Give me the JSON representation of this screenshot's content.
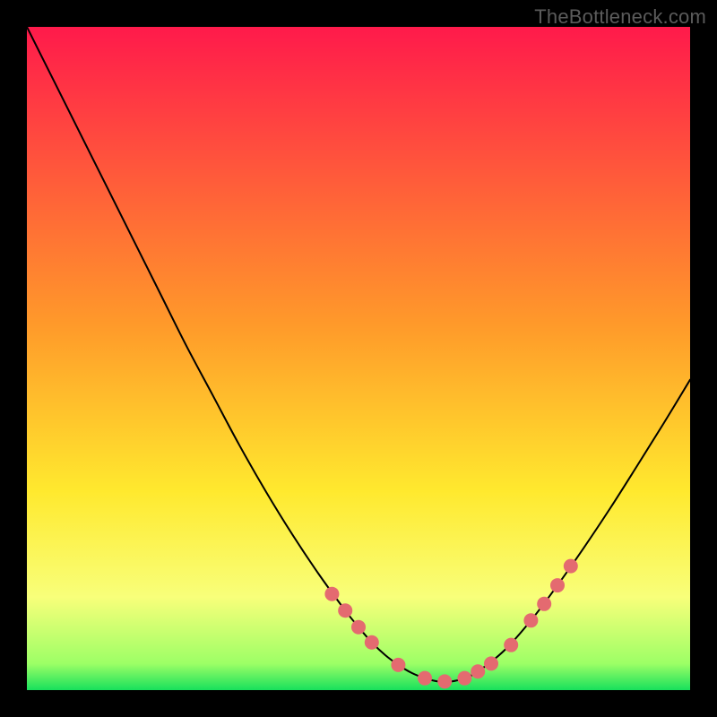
{
  "watermark": "TheBottleneck.com",
  "colors": {
    "gradient": [
      "#ff1a4b",
      "#ff9a2a",
      "#ffe92e",
      "#f8ff7a",
      "#9dff66",
      "#18e05c"
    ],
    "dot_fill": "#e46a70",
    "curve_stroke": "#000000"
  },
  "chart_data": {
    "type": "line",
    "title": "",
    "xlabel": "",
    "ylabel": "",
    "xlim": [
      0,
      100
    ],
    "ylim": [
      0,
      100
    ],
    "grid": false,
    "legend": false,
    "x": [
      0,
      4,
      8,
      12,
      16,
      20,
      24,
      28,
      32,
      36,
      40,
      44,
      48,
      50,
      52,
      54,
      56,
      58,
      60,
      62,
      64,
      66,
      68,
      72,
      76,
      80,
      84,
      88,
      92,
      96,
      100
    ],
    "y": [
      100,
      92,
      84,
      76,
      68,
      60,
      52,
      44.5,
      37,
      30,
      23.5,
      17.5,
      12,
      9.5,
      7.2,
      5.3,
      3.8,
      2.6,
      1.8,
      1.3,
      1.3,
      1.8,
      2.8,
      6.0,
      10.5,
      15.8,
      21.5,
      27.5,
      33.8,
      40.2,
      46.8
    ],
    "dot_x": [
      46,
      48,
      50,
      52,
      56,
      60,
      63,
      66,
      68,
      70,
      73,
      76,
      78,
      80,
      82
    ],
    "dot_y": [
      14.5,
      12.0,
      9.5,
      7.2,
      3.8,
      1.8,
      1.3,
      1.8,
      2.8,
      4.0,
      6.8,
      10.5,
      13.0,
      15.8,
      18.7
    ]
  }
}
